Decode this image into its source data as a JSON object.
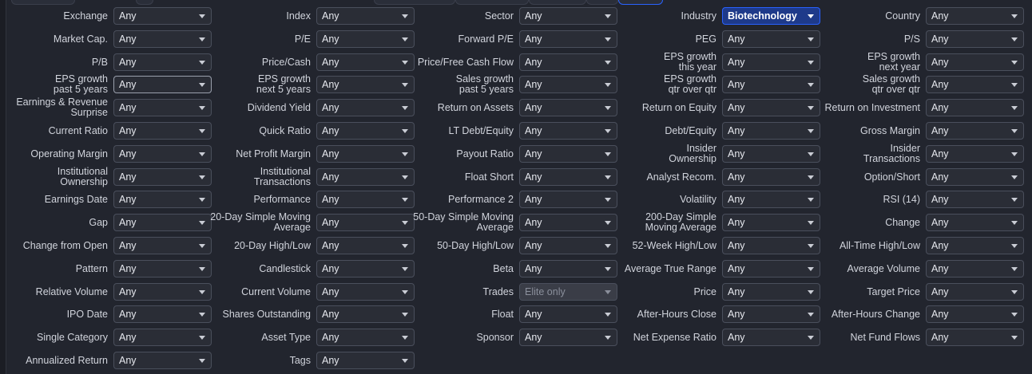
{
  "rows": [
    [
      [
        "Exchange",
        "Any"
      ],
      [
        "Index",
        "Any"
      ],
      [
        "Sector",
        "Any"
      ],
      [
        "Industry",
        "Biotechnology",
        "active"
      ],
      [
        "Country",
        "Any"
      ]
    ],
    [
      [
        "Market Cap.",
        "Any"
      ],
      [
        "P/E",
        "Any"
      ],
      [
        "Forward P/E",
        "Any"
      ],
      [
        "PEG",
        "Any"
      ],
      [
        "P/S",
        "Any"
      ]
    ],
    [
      [
        "P/B",
        "Any"
      ],
      [
        "Price/Cash",
        "Any"
      ],
      [
        "Price/Free Cash Flow",
        "Any"
      ],
      [
        "EPS growth this year",
        "Any"
      ],
      [
        "EPS growth next year",
        "Any"
      ]
    ],
    [
      [
        "EPS growth past 5 years",
        "Any",
        "focused"
      ],
      [
        "EPS growth next 5 years",
        "Any"
      ],
      [
        "Sales growth past 5 years",
        "Any"
      ],
      [
        "EPS growth qtr over qtr",
        "Any"
      ],
      [
        "Sales growth qtr over qtr",
        "Any"
      ]
    ],
    [
      [
        "Earnings & Revenue Surprise",
        "Any"
      ],
      [
        "Dividend Yield",
        "Any"
      ],
      [
        "Return on Assets",
        "Any"
      ],
      [
        "Return on Equity",
        "Any"
      ],
      [
        "Return on Investment",
        "Any"
      ]
    ],
    [
      [
        "Current Ratio",
        "Any"
      ],
      [
        "Quick Ratio",
        "Any"
      ],
      [
        "LT Debt/Equity",
        "Any"
      ],
      [
        "Debt/Equity",
        "Any"
      ],
      [
        "Gross Margin",
        "Any"
      ]
    ],
    [
      [
        "Operating Margin",
        "Any"
      ],
      [
        "Net Profit Margin",
        "Any"
      ],
      [
        "Payout Ratio",
        "Any"
      ],
      [
        "Insider Ownership",
        "Any"
      ],
      [
        "Insider Transactions",
        "Any"
      ]
    ],
    [
      [
        "Institutional Ownership",
        "Any"
      ],
      [
        "Institutional Transactions",
        "Any"
      ],
      [
        "Float Short",
        "Any"
      ],
      [
        "Analyst Recom.",
        "Any"
      ],
      [
        "Option/Short",
        "Any"
      ]
    ],
    [
      [
        "Earnings Date",
        "Any"
      ],
      [
        "Performance",
        "Any"
      ],
      [
        "Performance 2",
        "Any"
      ],
      [
        "Volatility",
        "Any"
      ],
      [
        "RSI (14)",
        "Any"
      ]
    ],
    [
      [
        "Gap",
        "Any"
      ],
      [
        "20-Day Simple Moving Average",
        "Any"
      ],
      [
        "50-Day Simple Moving Average",
        "Any"
      ],
      [
        "200-Day Simple Moving Average",
        "Any"
      ],
      [
        "Change",
        "Any"
      ]
    ],
    [
      [
        "Change from Open",
        "Any"
      ],
      [
        "20-Day High/Low",
        "Any"
      ],
      [
        "50-Day High/Low",
        "Any"
      ],
      [
        "52-Week High/Low",
        "Any"
      ],
      [
        "All-Time High/Low",
        "Any"
      ]
    ],
    [
      [
        "Pattern",
        "Any"
      ],
      [
        "Candlestick",
        "Any"
      ],
      [
        "Beta",
        "Any"
      ],
      [
        "Average True Range",
        "Any"
      ],
      [
        "Average Volume",
        "Any"
      ]
    ],
    [
      [
        "Relative Volume",
        "Any"
      ],
      [
        "Current Volume",
        "Any"
      ],
      [
        "Trades",
        "Elite only",
        "disabled"
      ],
      [
        "Price",
        "Any"
      ],
      [
        "Target Price",
        "Any"
      ]
    ],
    [
      [
        "IPO Date",
        "Any"
      ],
      [
        "Shares Outstanding",
        "Any"
      ],
      [
        "Float",
        "Any"
      ],
      [
        "After-Hours Close",
        "Any"
      ],
      [
        "After-Hours Change",
        "Any"
      ]
    ],
    [
      [
        "Single Category",
        "Any"
      ],
      [
        "Asset Type",
        "Any"
      ],
      [
        "Sponsor",
        "Any"
      ],
      [
        "Net Expense Ratio",
        "Any"
      ],
      [
        "Net Fund Flows",
        "Any"
      ]
    ],
    [
      [
        "Annualized Return",
        "Any"
      ],
      [
        "Tags",
        "Any"
      ]
    ]
  ],
  "two_line": {
    "EPS growth this year": [
      "EPS growth",
      "this year"
    ],
    "EPS growth next year": [
      "EPS growth",
      "next year"
    ],
    "EPS growth past 5 years": [
      "EPS growth",
      "past 5 years"
    ],
    "EPS growth next 5 years": [
      "EPS growth",
      "next 5 years"
    ],
    "Sales growth past 5 years": [
      "Sales growth",
      "past 5 years"
    ],
    "EPS growth qtr over qtr": [
      "EPS growth",
      "qtr over qtr"
    ],
    "Sales growth qtr over qtr": [
      "Sales growth",
      "qtr over qtr"
    ],
    "Earnings & Revenue Surprise": [
      "Earnings & Revenue",
      "Surprise"
    ],
    "Insider Ownership": [
      "Insider",
      "Ownership"
    ],
    "Insider Transactions": [
      "Insider",
      "Transactions"
    ],
    "Institutional Ownership": [
      "Institutional",
      "Ownership"
    ],
    "Institutional Transactions": [
      "Institutional",
      "Transactions"
    ],
    "20-Day Simple Moving Average": [
      "20-Day Simple Moving",
      "Average"
    ],
    "50-Day Simple Moving Average": [
      "50-Day Simple Moving",
      "Average"
    ],
    "200-Day Simple Moving Average": [
      "200-Day Simple",
      "Moving Average"
    ]
  },
  "colors": {
    "accent": "#2962ff",
    "active_bg": "#1e3a8a",
    "background": "#22252e"
  },
  "icons": {
    "caret": "chevron-down-icon"
  }
}
